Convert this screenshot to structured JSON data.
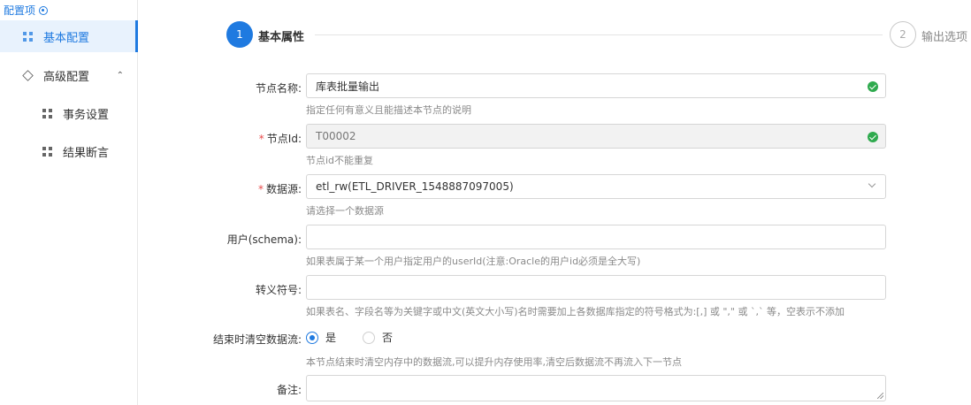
{
  "sidebar": {
    "title": "配置项",
    "items": [
      {
        "label": "基本配置"
      },
      {
        "label": "高级配置",
        "chevron": "⌃"
      },
      {
        "label": "事务设置"
      },
      {
        "label": "结果断言"
      }
    ]
  },
  "steps": [
    {
      "number": "1",
      "label": "基本属性"
    },
    {
      "number": "2",
      "label": "输出选项"
    }
  ],
  "form": {
    "node_name": {
      "label": "节点名称:",
      "value": "库表批量输出",
      "help": "指定任何有意义且能描述本节点的说明"
    },
    "node_id": {
      "label": "节点Id:",
      "required": "*",
      "value": "T00002",
      "help": "节点id不能重复"
    },
    "datasource": {
      "label": "数据源:",
      "required": "*",
      "value": "etl_rw(ETL_DRIVER_1548887097005)",
      "help": "请选择一个数据源"
    },
    "schema": {
      "label": "用户(schema):",
      "value": "",
      "help": "如果表属于某一个用户指定用户的userId(注意:Oracle的用户id必须是全大写)"
    },
    "escape": {
      "label": "转义符号:",
      "value": "",
      "help": "如果表名、字段名等为关键字或中文(英文大小写)名时需要加上各数据库指定的符号格式为:[,] 或 \",\" 或 `,` 等，空表示不添加"
    },
    "clear_stream": {
      "label": "结束时清空数据流:",
      "options": [
        "是",
        "否"
      ],
      "selected": "是",
      "help": "本节点结束时清空内存中的数据流,可以提升内存使用率,清空后数据流不再流入下一节点"
    },
    "remark": {
      "label": "备注:",
      "value": ""
    }
  },
  "colors": {
    "accent": "#1f7ae0",
    "success": "#2faa4e",
    "required": "#e84a4a"
  }
}
